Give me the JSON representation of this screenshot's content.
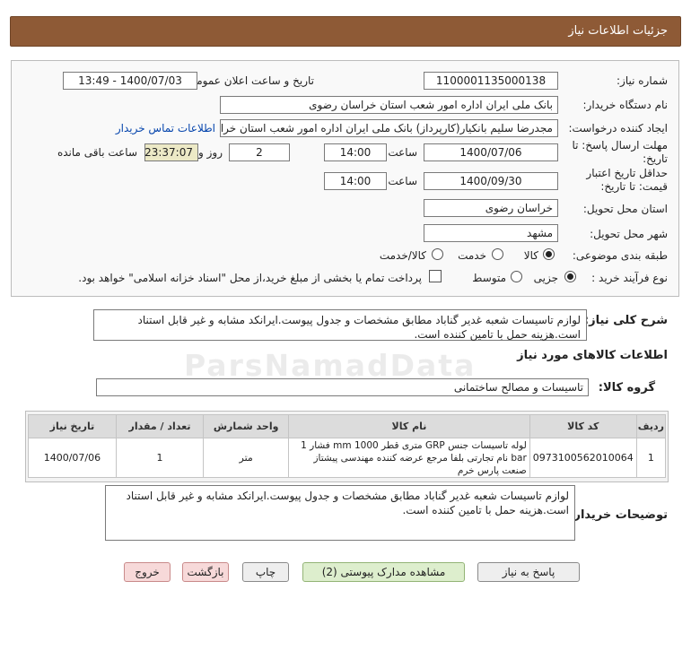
{
  "header": {
    "title": "جزئیات اطلاعات نیاز"
  },
  "form": {
    "need_number_label": "شماره نیاز:",
    "need_number": "1100001135000138",
    "announce_label": "تاریخ و ساعت اعلان عمومی:",
    "announce_value": "1400/07/03 - 13:49",
    "buyer_label": "نام دستگاه خریدار:",
    "buyer_value": "بانک ملی ایران اداره امور شعب استان خراسان رضوی",
    "creator_label": "ایجاد کننده درخواست:",
    "creator_value": "مجدرضا سلیم  بانکیار(کارپرداز) بانک ملی ایران اداره امور شعب استان خراسان ر",
    "contact_link": "اطلاعات تماس خریدار",
    "deadline_label": "مهلت ارسال پاسخ: تا تاریخ:",
    "deadline_date": "1400/07/06",
    "time_label": "ساعت",
    "deadline_time": "14:00",
    "days_value": "2",
    "days_label": "روز و",
    "remaining_value": "23:37:07",
    "remaining_label": "ساعت باقی مانده",
    "validity_label": "حداقل تاریخ اعتبار قیمت: تا تاریخ:",
    "validity_date": "1400/09/30",
    "validity_time": "14:00",
    "province_label": "استان محل تحویل:",
    "province_value": "خراسان رضوی",
    "city_label": "شهر محل تحویل:",
    "city_value": "مشهد",
    "category_label": "طبقه بندی موضوعی:",
    "cat_goods": "کالا",
    "cat_service": "خدمت",
    "cat_both": "کالا/خدمت",
    "process_label": "نوع فرآیند خرید :",
    "proc_partial": "جزیی",
    "proc_medium": "متوسط",
    "payment_note": "پرداخت تمام یا بخشی از مبلغ خرید،از محل \"اسناد خزانه اسلامی\" خواهد بود."
  },
  "summary": {
    "label": "شرح کلی نیاز:",
    "text": "لوازم تاسیسات شعبه غدیر گناباد مطابق مشخصات و جدول پیوست.ایرانکد مشابه و غیر قابل استناد است.هزینه حمل با تامین کننده است."
  },
  "goods_section": {
    "title": "اطلاعات کالاهای مورد نیاز",
    "group_label": "گروه کالا:",
    "group_value": "تاسیسات و مصالح ساختمانی"
  },
  "table": {
    "headers": [
      "ردیف",
      "کد کالا",
      "نام کالا",
      "واحد شمارش",
      "تعداد / مقدار",
      "تاریخ نیاز"
    ],
    "rows": [
      {
        "row": "1",
        "code": "0973100562010064",
        "name": "لوله تاسیسات جنس GRP متری قطر 1000 mm فشار 1 bar نام تجارتی بلفا مرجع عرضه کننده مهندسی پیشتاز صنعت پارس خرم",
        "unit": "متر",
        "qty": "1",
        "date": "1400/07/06"
      }
    ]
  },
  "buyer_notes": {
    "label": "توضیحات خریدار:",
    "text": "لوازم تاسیسات شعبه غدیر گناباد مطابق مشخصات و جدول پیوست.ایرانکد مشابه و غیر قابل استناد است.هزینه حمل با تامین کننده است."
  },
  "buttons": {
    "reply": "پاسخ به نیاز",
    "docs": "مشاهده مدارک پیوستی (2)",
    "print": "چاپ",
    "back": "بازگشت",
    "exit": "خروج"
  },
  "watermark": "ParsNamadData"
}
